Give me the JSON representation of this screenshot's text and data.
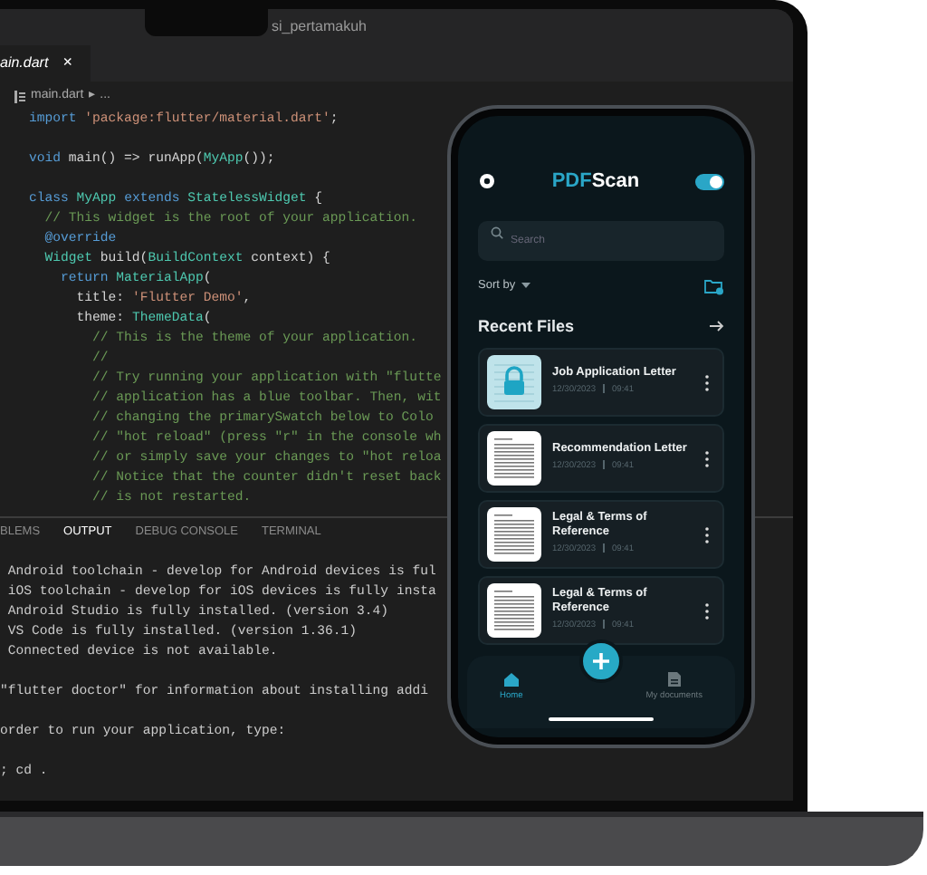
{
  "window": {
    "title": "si_pertamakuh"
  },
  "tabs": [
    {
      "label": "ain.dart",
      "close": "×",
      "selected": true
    }
  ],
  "breadcrumb": {
    "file": "main.dart",
    "rest": "▸ ..."
  },
  "code_lines": [
    {
      "tokens": [
        {
          "kind": "keyword",
          "text": "import "
        },
        {
          "kind": "string",
          "text": "'package:flutter/material.dart'"
        },
        {
          "kind": "plain",
          "text": ";"
        }
      ]
    },
    {
      "gap_before": true,
      "tokens": [
        {
          "kind": "keyword",
          "text": "void "
        },
        {
          "kind": "plain",
          "text": "main() => runApp("
        },
        {
          "kind": "class",
          "text": "MyApp"
        },
        {
          "kind": "plain",
          "text": "());"
        }
      ]
    },
    {
      "gap_before": true,
      "tokens": [
        {
          "kind": "keyword",
          "text": "class "
        },
        {
          "kind": "class",
          "text": "MyApp"
        },
        {
          "kind": "keyword",
          "text": " extends "
        },
        {
          "kind": "class",
          "text": "StatelessWidget"
        },
        {
          "kind": "plain",
          "text": " {"
        }
      ]
    },
    {
      "tokens": [
        {
          "kind": "comment",
          "text": "  // This widget is the root of your application."
        }
      ]
    },
    {
      "tokens": [
        {
          "kind": "keyword",
          "text": "  @override"
        }
      ]
    },
    {
      "tokens": [
        {
          "kind": "class",
          "text": "  Widget"
        },
        {
          "kind": "plain",
          "text": " build("
        },
        {
          "kind": "class",
          "text": "BuildContext"
        },
        {
          "kind": "plain",
          "text": " context) {"
        }
      ]
    },
    {
      "tokens": [
        {
          "kind": "keyword",
          "text": "    return "
        },
        {
          "kind": "class",
          "text": "MaterialApp"
        },
        {
          "kind": "plain",
          "text": "("
        }
      ]
    },
    {
      "tokens": [
        {
          "kind": "plain",
          "text": "      title: "
        },
        {
          "kind": "string",
          "text": "'Flutter Demo'"
        },
        {
          "kind": "plain",
          "text": ","
        }
      ]
    },
    {
      "tokens": [
        {
          "kind": "plain",
          "text": "      theme: "
        },
        {
          "kind": "class",
          "text": "ThemeData"
        },
        {
          "kind": "plain",
          "text": "("
        }
      ]
    },
    {
      "tokens": [
        {
          "kind": "comment",
          "text": "        // This is the theme of your application."
        }
      ]
    },
    {
      "tokens": [
        {
          "kind": "comment",
          "text": "        //"
        }
      ]
    },
    {
      "tokens": [
        {
          "kind": "comment",
          "text": "        // Try running your application with \"flutte"
        }
      ]
    },
    {
      "tokens": [
        {
          "kind": "comment",
          "text": "        // application has a blue toolbar. Then, wit"
        }
      ]
    },
    {
      "tokens": [
        {
          "kind": "comment",
          "text": "        // changing the primarySwatch below to Colo"
        }
      ]
    },
    {
      "tokens": [
        {
          "kind": "comment",
          "text": "        // \"hot reload\" (press \"r\" in the console wh"
        }
      ]
    },
    {
      "tokens": [
        {
          "kind": "comment",
          "text": "        // or simply save your changes to \"hot reloa"
        }
      ]
    },
    {
      "tokens": [
        {
          "kind": "comment",
          "text": "        // Notice that the counter didn't reset back"
        }
      ]
    },
    {
      "tokens": [
        {
          "kind": "comment",
          "text": "        // is not restarted."
        }
      ]
    }
  ],
  "panel_tabs": [
    {
      "label": "BLEMS",
      "selected": false
    },
    {
      "label": "OUTPUT",
      "selected": true
    },
    {
      "label": "DEBUG CONSOLE",
      "selected": false
    },
    {
      "label": "TERMINAL",
      "selected": false
    }
  ],
  "output_lines": [
    {
      "text": " Android toolchain - develop for Android devices is ful"
    },
    {
      "text": " iOS toolchain - develop for iOS devices is fully insta"
    },
    {
      "text": " Android Studio is fully installed. (version 3.4)"
    },
    {
      "text": " VS Code is fully installed. (version 1.36.1)"
    },
    {
      "text": " Connected device is not available."
    },
    {
      "text": "\"flutter doctor\" for information about installing addi",
      "gap_before": true
    },
    {
      "text": "order to run your application, type:",
      "gap_before": true
    },
    {
      "text": "; cd .",
      "gap_before": true
    }
  ],
  "phone": {
    "app_title": {
      "accent": "PDF",
      "rest": "Scan"
    },
    "dark_mode": {
      "on": true
    },
    "search": {
      "placeholder": "Search"
    },
    "sort": {
      "label": "Sort by"
    },
    "section_title": "Recent Files",
    "files": [
      {
        "name": "Job Application Letter",
        "date": "12/30/2023",
        "time": "09:41",
        "kind": "locked"
      },
      {
        "name": "Recommendation Letter",
        "date": "12/30/2023",
        "time": "09:41",
        "kind": "document"
      },
      {
        "name": "Legal & Terms of Reference",
        "date": "12/30/2023",
        "time": "09:41",
        "kind": "document"
      },
      {
        "name": "Legal & Terms of Reference",
        "date": "12/30/2023",
        "time": "09:41",
        "kind": "document"
      }
    ],
    "nav": [
      {
        "label": "Home",
        "kind": "home",
        "selected": true
      },
      {
        "label": "My documents",
        "kind": "documents",
        "selected": false
      }
    ]
  }
}
